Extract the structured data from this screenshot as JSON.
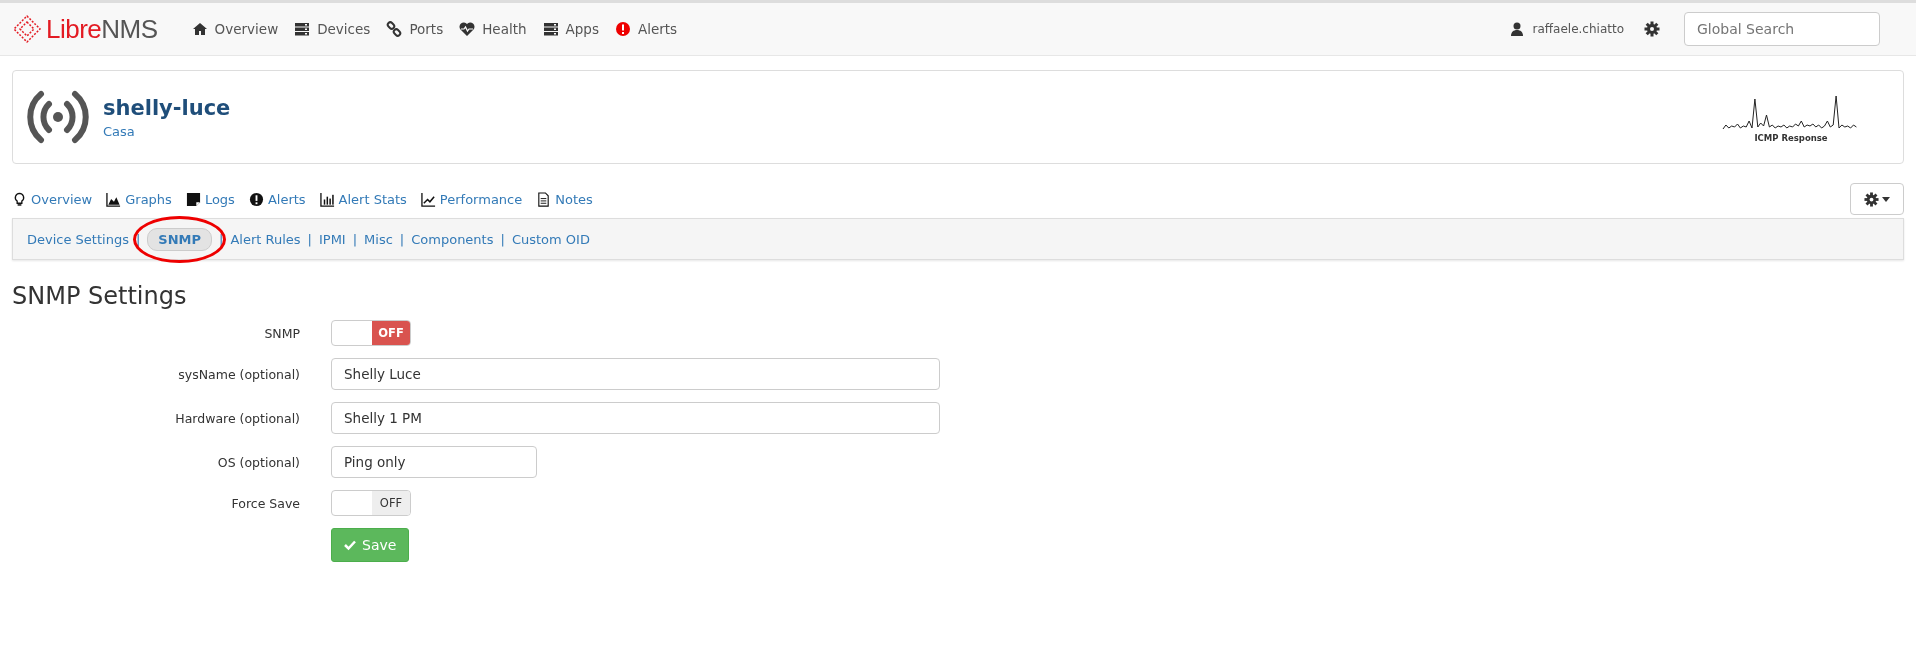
{
  "navbar": {
    "logo": {
      "part_a": "Libre",
      "part_b": "NMS"
    },
    "items": [
      {
        "label": "Overview"
      },
      {
        "label": "Devices"
      },
      {
        "label": "Ports"
      },
      {
        "label": "Health"
      },
      {
        "label": "Apps"
      },
      {
        "label": "Alerts"
      }
    ],
    "user": "raffaele.chiatto",
    "search": {
      "placeholder": "Global Search"
    }
  },
  "device": {
    "name": "shelly-luce",
    "location": "Casa",
    "graph_caption": "ICMP Response"
  },
  "tabs": [
    {
      "label": "Overview"
    },
    {
      "label": "Graphs"
    },
    {
      "label": "Logs"
    },
    {
      "label": "Alerts"
    },
    {
      "label": "Alert Stats"
    },
    {
      "label": "Performance"
    },
    {
      "label": "Notes"
    }
  ],
  "subnav": [
    {
      "label": "Device Settings",
      "selected": false,
      "circled": false
    },
    {
      "separator": "|",
      "label": "SNMP",
      "selected": true,
      "circled": true
    },
    {
      "separator": "|",
      "label": "Alert Rules",
      "selected": false,
      "circled": false
    },
    {
      "separator": "|",
      "label": "IPMI",
      "selected": false,
      "circled": false
    },
    {
      "separator": "|",
      "label": "Misc",
      "selected": false,
      "circled": false
    },
    {
      "separator": "|",
      "label": "Components",
      "selected": false,
      "circled": false
    },
    {
      "separator": "|",
      "label": "Custom OID",
      "selected": false,
      "circled": false
    }
  ],
  "form": {
    "title": "SNMP Settings",
    "rows": [
      {
        "kind": "switch",
        "label": "SNMP",
        "on": false,
        "state_text": "OFF",
        "color": "#d9534f"
      },
      {
        "kind": "text",
        "label": "sysName (optional)",
        "value": "Shelly Luce"
      },
      {
        "kind": "text",
        "label": "Hardware (optional)",
        "value": "Shelly 1 PM"
      },
      {
        "kind": "short_text",
        "label": "OS (optional)",
        "value": "Ping only"
      },
      {
        "kind": "switch",
        "label": "Force Save",
        "on": false,
        "state_text": "OFF",
        "color": "#eeeeee"
      }
    ],
    "save_button": "Save"
  }
}
